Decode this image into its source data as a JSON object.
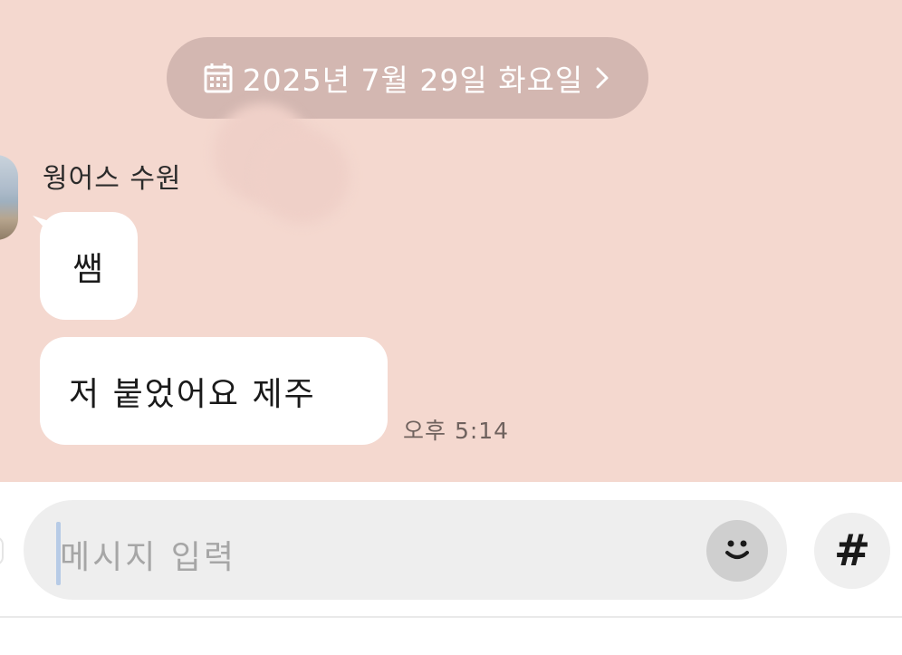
{
  "date_bar": {
    "date_text": "2025년 7월 29일 화요일",
    "calendar_icon": "calendar-icon",
    "chevron_icon": "chevron-right-icon"
  },
  "message_group": {
    "sender_name": "웡어스 수원",
    "messages": [
      {
        "text": "쌤"
      },
      {
        "text": "저 붙었어요 제주"
      }
    ],
    "time": "오후 5:14"
  },
  "composer": {
    "placeholder": "메시지 입력",
    "emoji_icon": "smiley-icon",
    "hashtag_label": "#"
  },
  "colors": {
    "chat_background": "#f4d8cf",
    "date_pill": "#d3b7b1",
    "bubble": "#ffffff",
    "input_background": "#eeeeee"
  }
}
